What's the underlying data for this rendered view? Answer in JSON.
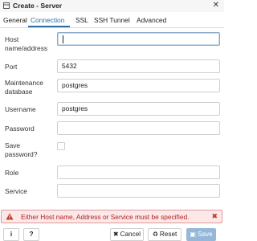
{
  "window": {
    "title": "Create - Server",
    "close_glyph": "✕"
  },
  "tabs": [
    {
      "label": "General",
      "active": false
    },
    {
      "label": "Connection",
      "active": true
    },
    {
      "label": "SSL",
      "active": false
    },
    {
      "label": "SSH Tunnel",
      "active": false
    },
    {
      "label": "Advanced",
      "active": false
    }
  ],
  "form": {
    "host": {
      "label": "Host name/address",
      "value": ""
    },
    "port": {
      "label": "Port",
      "value": "5432"
    },
    "maintenance_db": {
      "label": "Maintenance database",
      "value": "postgres"
    },
    "username": {
      "label": "Username",
      "value": "postgres"
    },
    "password": {
      "label": "Password",
      "value": ""
    },
    "save_password": {
      "label": "Save password?",
      "checked": false
    },
    "role": {
      "label": "Role",
      "value": ""
    },
    "service": {
      "label": "Service",
      "value": ""
    }
  },
  "error": {
    "message": "Either Host name, Address or Service must be specified.",
    "icon": "warning-icon",
    "close_glyph": "✖"
  },
  "footer": {
    "info_label": "i",
    "help_label": "?",
    "cancel_label": "Cancel",
    "reset_label": "Reset",
    "save_label": "Save"
  },
  "colors": {
    "accent": "#2d6da3",
    "error_bg": "#fce8e8",
    "error_text": "#b22222",
    "save_button": "#95b8d8"
  }
}
